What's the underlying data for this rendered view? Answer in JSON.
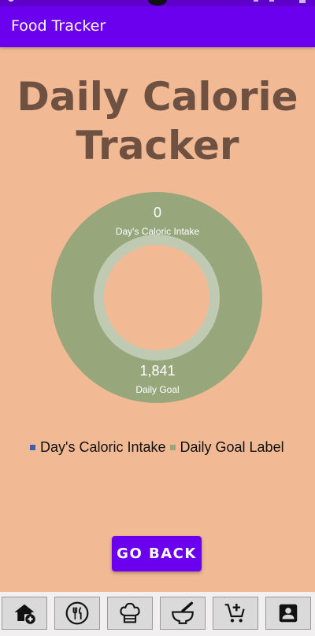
{
  "app_bar": {
    "title": "Food Tracker"
  },
  "page": {
    "title": "Daily Calorie Tracker"
  },
  "chart_data": {
    "type": "pie",
    "subtype": "double-ring donut",
    "series": [
      {
        "name": "Day's Caloric Intake",
        "value": 0,
        "value_label": "0",
        "color": "#3F5FA8"
      },
      {
        "name": "Daily Goal Label",
        "value": 1841,
        "value_label": "1,841",
        "color": "#97A77B"
      }
    ],
    "ring_labels": [
      {
        "value": "0",
        "label": "Day's Caloric Intake"
      },
      {
        "value": "1,841",
        "label": "Daily Goal"
      }
    ],
    "legend": [
      "Day's Caloric Intake",
      "Daily Goal Label"
    ],
    "legend_position": "bottom",
    "inner_ring_color": "#C0CAB2",
    "outer_ring_color": "#97A77B"
  },
  "buttons": {
    "go_back": "GO BACK"
  },
  "colors": {
    "background": "#F1B994",
    "accent": "#6A00EE",
    "title_text": "#6E5140"
  },
  "bottom_nav": {
    "items": [
      {
        "icon": "home-add-icon"
      },
      {
        "icon": "restaurant-icon"
      },
      {
        "icon": "chef-hat-icon"
      },
      {
        "icon": "mortar-pestle-icon"
      },
      {
        "icon": "add-cart-icon"
      },
      {
        "icon": "account-box-icon"
      }
    ]
  }
}
